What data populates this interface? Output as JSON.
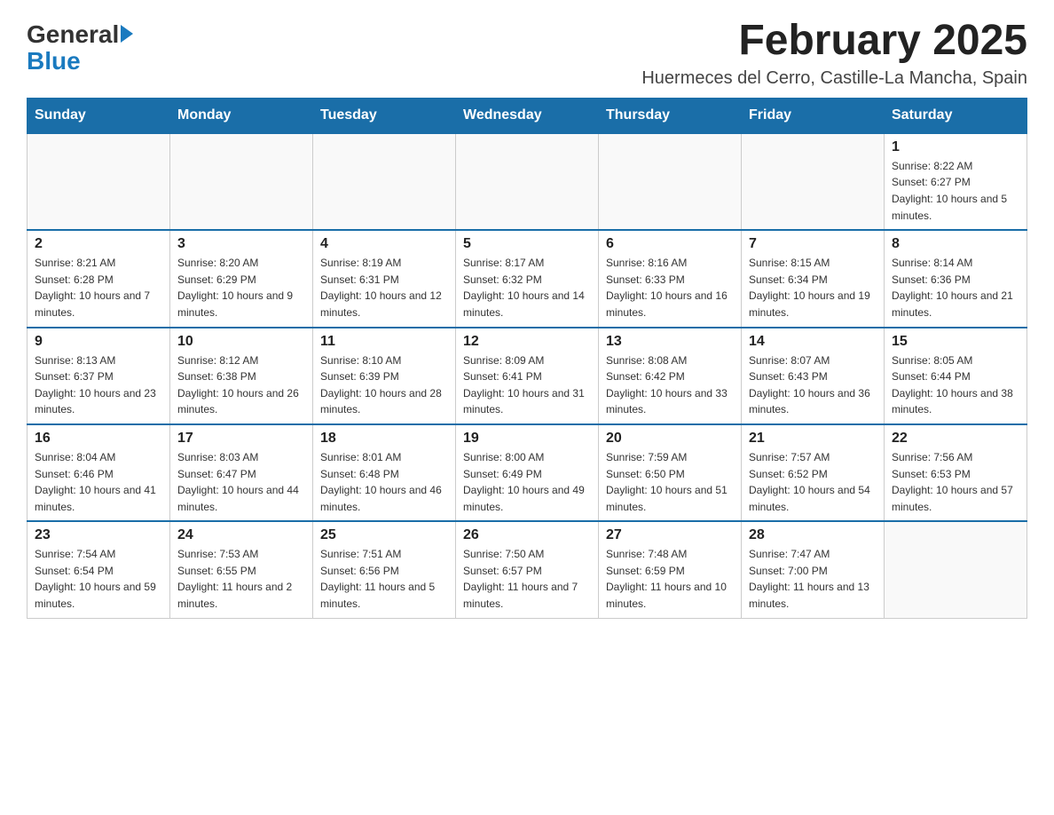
{
  "logo": {
    "general": "General",
    "blue": "Blue"
  },
  "title": "February 2025",
  "subtitle": "Huermeces del Cerro, Castille-La Mancha, Spain",
  "weekdays": [
    "Sunday",
    "Monday",
    "Tuesday",
    "Wednesday",
    "Thursday",
    "Friday",
    "Saturday"
  ],
  "weeks": [
    [
      {
        "day": "",
        "info": ""
      },
      {
        "day": "",
        "info": ""
      },
      {
        "day": "",
        "info": ""
      },
      {
        "day": "",
        "info": ""
      },
      {
        "day": "",
        "info": ""
      },
      {
        "day": "",
        "info": ""
      },
      {
        "day": "1",
        "info": "Sunrise: 8:22 AM\nSunset: 6:27 PM\nDaylight: 10 hours and 5 minutes."
      }
    ],
    [
      {
        "day": "2",
        "info": "Sunrise: 8:21 AM\nSunset: 6:28 PM\nDaylight: 10 hours and 7 minutes."
      },
      {
        "day": "3",
        "info": "Sunrise: 8:20 AM\nSunset: 6:29 PM\nDaylight: 10 hours and 9 minutes."
      },
      {
        "day": "4",
        "info": "Sunrise: 8:19 AM\nSunset: 6:31 PM\nDaylight: 10 hours and 12 minutes."
      },
      {
        "day": "5",
        "info": "Sunrise: 8:17 AM\nSunset: 6:32 PM\nDaylight: 10 hours and 14 minutes."
      },
      {
        "day": "6",
        "info": "Sunrise: 8:16 AM\nSunset: 6:33 PM\nDaylight: 10 hours and 16 minutes."
      },
      {
        "day": "7",
        "info": "Sunrise: 8:15 AM\nSunset: 6:34 PM\nDaylight: 10 hours and 19 minutes."
      },
      {
        "day": "8",
        "info": "Sunrise: 8:14 AM\nSunset: 6:36 PM\nDaylight: 10 hours and 21 minutes."
      }
    ],
    [
      {
        "day": "9",
        "info": "Sunrise: 8:13 AM\nSunset: 6:37 PM\nDaylight: 10 hours and 23 minutes."
      },
      {
        "day": "10",
        "info": "Sunrise: 8:12 AM\nSunset: 6:38 PM\nDaylight: 10 hours and 26 minutes."
      },
      {
        "day": "11",
        "info": "Sunrise: 8:10 AM\nSunset: 6:39 PM\nDaylight: 10 hours and 28 minutes."
      },
      {
        "day": "12",
        "info": "Sunrise: 8:09 AM\nSunset: 6:41 PM\nDaylight: 10 hours and 31 minutes."
      },
      {
        "day": "13",
        "info": "Sunrise: 8:08 AM\nSunset: 6:42 PM\nDaylight: 10 hours and 33 minutes."
      },
      {
        "day": "14",
        "info": "Sunrise: 8:07 AM\nSunset: 6:43 PM\nDaylight: 10 hours and 36 minutes."
      },
      {
        "day": "15",
        "info": "Sunrise: 8:05 AM\nSunset: 6:44 PM\nDaylight: 10 hours and 38 minutes."
      }
    ],
    [
      {
        "day": "16",
        "info": "Sunrise: 8:04 AM\nSunset: 6:46 PM\nDaylight: 10 hours and 41 minutes."
      },
      {
        "day": "17",
        "info": "Sunrise: 8:03 AM\nSunset: 6:47 PM\nDaylight: 10 hours and 44 minutes."
      },
      {
        "day": "18",
        "info": "Sunrise: 8:01 AM\nSunset: 6:48 PM\nDaylight: 10 hours and 46 minutes."
      },
      {
        "day": "19",
        "info": "Sunrise: 8:00 AM\nSunset: 6:49 PM\nDaylight: 10 hours and 49 minutes."
      },
      {
        "day": "20",
        "info": "Sunrise: 7:59 AM\nSunset: 6:50 PM\nDaylight: 10 hours and 51 minutes."
      },
      {
        "day": "21",
        "info": "Sunrise: 7:57 AM\nSunset: 6:52 PM\nDaylight: 10 hours and 54 minutes."
      },
      {
        "day": "22",
        "info": "Sunrise: 7:56 AM\nSunset: 6:53 PM\nDaylight: 10 hours and 57 minutes."
      }
    ],
    [
      {
        "day": "23",
        "info": "Sunrise: 7:54 AM\nSunset: 6:54 PM\nDaylight: 10 hours and 59 minutes."
      },
      {
        "day": "24",
        "info": "Sunrise: 7:53 AM\nSunset: 6:55 PM\nDaylight: 11 hours and 2 minutes."
      },
      {
        "day": "25",
        "info": "Sunrise: 7:51 AM\nSunset: 6:56 PM\nDaylight: 11 hours and 5 minutes."
      },
      {
        "day": "26",
        "info": "Sunrise: 7:50 AM\nSunset: 6:57 PM\nDaylight: 11 hours and 7 minutes."
      },
      {
        "day": "27",
        "info": "Sunrise: 7:48 AM\nSunset: 6:59 PM\nDaylight: 11 hours and 10 minutes."
      },
      {
        "day": "28",
        "info": "Sunrise: 7:47 AM\nSunset: 7:00 PM\nDaylight: 11 hours and 13 minutes."
      },
      {
        "day": "",
        "info": ""
      }
    ]
  ]
}
